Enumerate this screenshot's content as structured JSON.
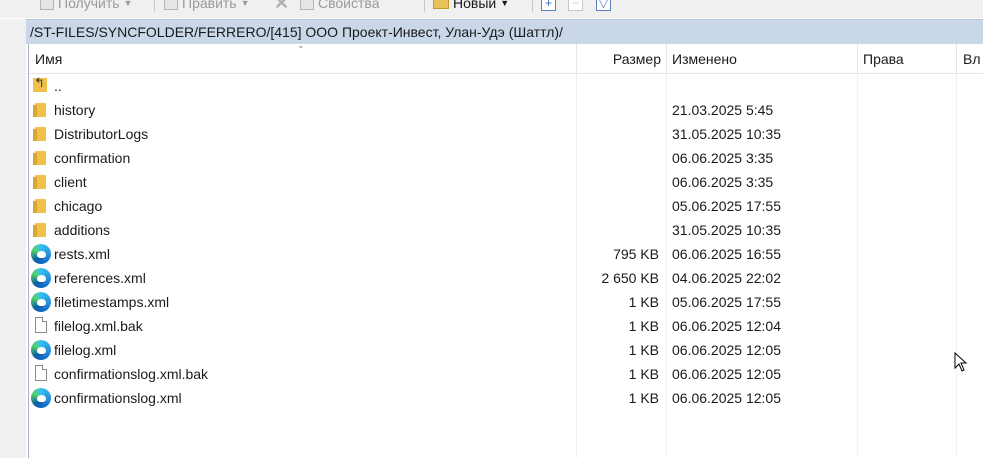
{
  "toolbar": {
    "get_label": "Получить",
    "edit_label": "Править",
    "properties_label": "Свойства",
    "new_label": "Новый"
  },
  "path": "/ST-FILES/SYNCFOLDER/FERRERO/[415] ООО Проект-Инвест, Улан-Удэ (Шаттл)/",
  "columns": {
    "name": "Имя",
    "size": "Размер",
    "modified": "Изменено",
    "rights": "Права",
    "owner": "Вл"
  },
  "files": [
    {
      "name": "..",
      "size": "",
      "modified": "",
      "icon": "parent-folder-icon"
    },
    {
      "name": "history",
      "size": "",
      "modified": "21.03.2025 5:45",
      "icon": "folder-icon"
    },
    {
      "name": "DistributorLogs",
      "size": "",
      "modified": "31.05.2025 10:35",
      "icon": "folder-icon"
    },
    {
      "name": "confirmation",
      "size": "",
      "modified": "06.06.2025 3:35",
      "icon": "folder-icon"
    },
    {
      "name": "client",
      "size": "",
      "modified": "06.06.2025 3:35",
      "icon": "folder-icon"
    },
    {
      "name": "chicago",
      "size": "",
      "modified": "05.06.2025 17:55",
      "icon": "folder-icon"
    },
    {
      "name": "additions",
      "size": "",
      "modified": "31.05.2025 10:35",
      "icon": "folder-icon"
    },
    {
      "name": "rests.xml",
      "size": "795 KB",
      "modified": "06.06.2025 16:55",
      "icon": "edge-xml-icon"
    },
    {
      "name": "references.xml",
      "size": "2 650 KB",
      "modified": "04.06.2025 22:02",
      "icon": "edge-xml-icon"
    },
    {
      "name": "filetimestamps.xml",
      "size": "1 KB",
      "modified": "05.06.2025 17:55",
      "icon": "edge-xml-icon"
    },
    {
      "name": "filelog.xml.bak",
      "size": "1 KB",
      "modified": "06.06.2025 12:04",
      "icon": "file-icon"
    },
    {
      "name": "filelog.xml",
      "size": "1 KB",
      "modified": "06.06.2025 12:05",
      "icon": "edge-xml-icon"
    },
    {
      "name": "confirmationslog.xml.bak",
      "size": "1 KB",
      "modified": "06.06.2025 12:05",
      "icon": "file-icon"
    },
    {
      "name": "confirmationslog.xml",
      "size": "1 KB",
      "modified": "06.06.2025 12:05",
      "icon": "edge-xml-icon"
    }
  ]
}
